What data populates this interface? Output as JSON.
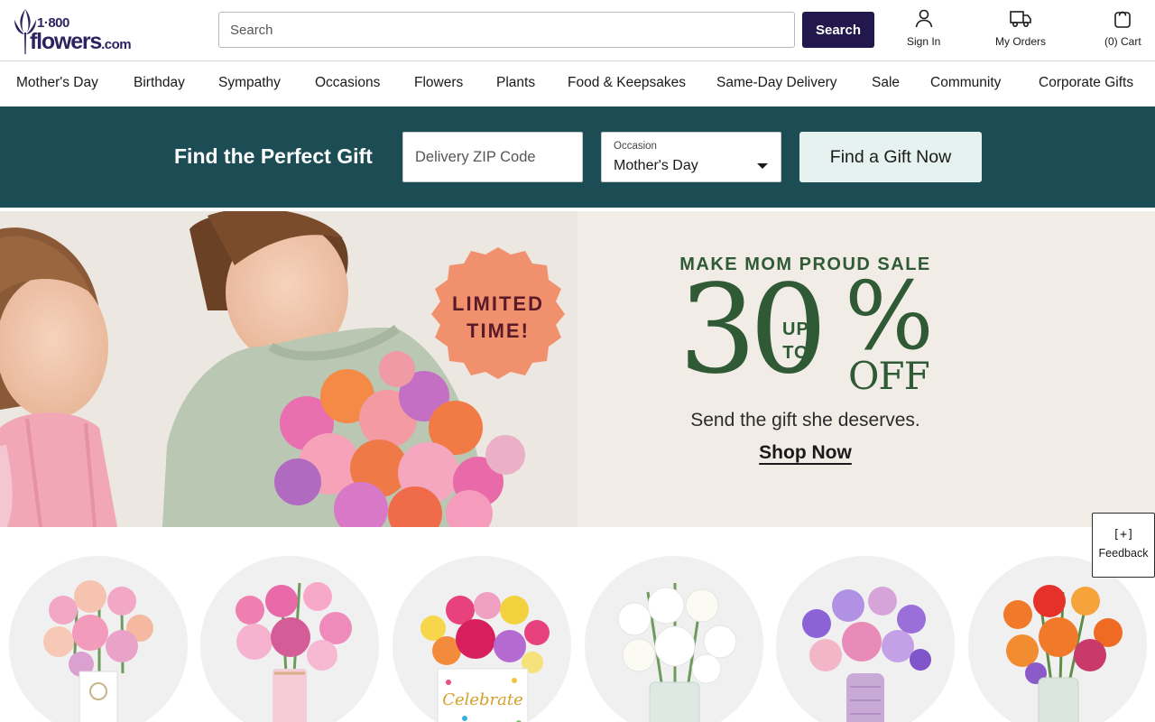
{
  "brand": {
    "number": "1·800",
    "name": "flowers",
    "tld": ".com"
  },
  "header": {
    "search_placeholder": "Search",
    "search_button": "Search",
    "sign_in": "Sign In",
    "my_orders": "My Orders",
    "cart": "(0) Cart",
    "icons": {
      "sign_in": "person-icon",
      "orders": "truck-icon",
      "cart": "shopping-bag-icon"
    }
  },
  "nav": {
    "items": [
      "Mother's Day",
      "Birthday",
      "Sympathy",
      "Occasions",
      "Flowers",
      "Plants",
      "Food & Keepsakes",
      "Same-Day Delivery",
      "Sale",
      "Community",
      "Corporate Gifts"
    ]
  },
  "gift_finder": {
    "title": "Find the Perfect Gift",
    "zip_placeholder": "Delivery ZIP Code",
    "occasion_label": "Occasion",
    "occasion_value": "Mother's Day",
    "button": "Find a Gift Now"
  },
  "hero": {
    "badge_line1": "LIMITED",
    "badge_line2": "TIME!",
    "kicker": "MAKE MOM PROUD SALE",
    "number": "30",
    "up": "UP",
    "to": "TO",
    "percent": "%",
    "off": "OFF",
    "subtitle": "Send the gift she deserves.",
    "cta": "Shop Now"
  },
  "products": {
    "items": [
      {
        "kind": "pastel-bouquet-square-vase"
      },
      {
        "kind": "pink-lily-bouquet-pink-vase"
      },
      {
        "kind": "celebrate-box-bouquet",
        "label": "Celebrate"
      },
      {
        "kind": "white-lily-bouquet-glass-vase"
      },
      {
        "kind": "purple-bouquet-purple-vase"
      },
      {
        "kind": "orange-lily-bouquet-glass-vase"
      }
    ]
  },
  "feedback": {
    "icon": "[+]",
    "label": "Feedback"
  },
  "colors": {
    "brand_navy": "#22184d",
    "finder_teal": "#1c4d55",
    "promo_green": "#2f5a35",
    "hero_bg": "#f1ece6",
    "badge_salmon": "#f0906d"
  }
}
